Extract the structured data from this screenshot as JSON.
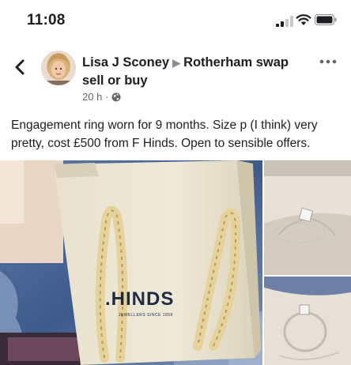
{
  "status_bar": {
    "time": "11:08"
  },
  "post": {
    "author": "Lisa J Sconey",
    "group": "Rotherham swap sell or buy",
    "timestamp": "20 h ·",
    "caption": "Engagement ring worn for 9 months. Size p (I think) very pretty, cost £500 from F Hinds. Open to sensible offers."
  },
  "photos": {
    "bag_brand": ".HINDS",
    "bag_tagline": "JEWELLERS SINCE 1856"
  },
  "icons": {
    "back": "chevron-left-icon",
    "more": "more-horizontal-icon",
    "audience": "globe-icon",
    "signal": "cellular-signal-icon",
    "wifi": "wifi-icon",
    "battery": "battery-icon"
  }
}
